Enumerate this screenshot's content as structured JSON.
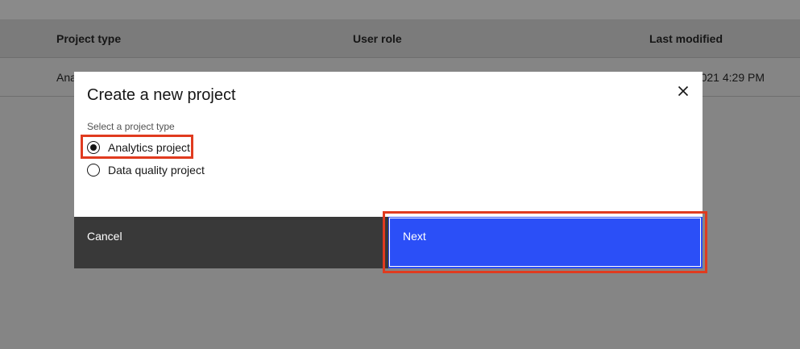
{
  "table": {
    "columns": [
      "Project type",
      "User role",
      "Last modified"
    ],
    "row": {
      "project_type_partial": "Ana",
      "last_modified_partial": "021 4:29 PM"
    }
  },
  "modal": {
    "title": "Create a new project",
    "fieldset_label": "Select a project type",
    "options": [
      {
        "label": "Analytics project",
        "selected": true
      },
      {
        "label": "Data quality project",
        "selected": false
      }
    ],
    "cancel_label": "Cancel",
    "next_label": "Next",
    "close_icon": "close-icon"
  },
  "colors": {
    "primary": "#2b4ff7",
    "secondary": "#393939",
    "highlight": "#e03b1f",
    "overlay": "rgba(22,22,22,0.5)"
  }
}
